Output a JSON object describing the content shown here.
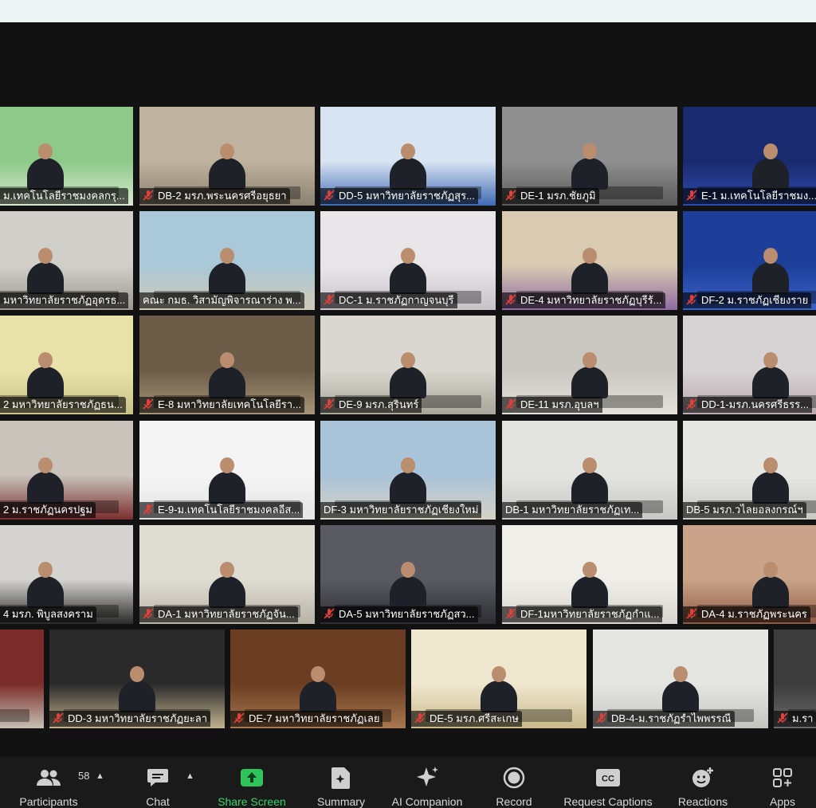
{
  "colors": {
    "accent_green": "#2fc45c",
    "mute_red": "#e0403a",
    "toolbar_bg": "#1a1a1a",
    "stage_bg": "#121212"
  },
  "tiles": [
    {
      "label": "ม.เทคโนโลยีราชมงคลกรุ...",
      "muted": false,
      "bg": "#8ec98a",
      "bg2": "#d8e9cf"
    },
    {
      "label": "DB-2 มรภ.พระนครศรีอยุธยา",
      "muted": true,
      "bg": "#bfb39f",
      "bg2": "#8b8170"
    },
    {
      "label": "DD-5 มหาวิทยาลัยราชภัฏสุร...",
      "muted": true,
      "bg": "#d9e4f2",
      "bg2": "#3f6bb5"
    },
    {
      "label": "DE-1 มรภ.ชัยภูมิ",
      "muted": true,
      "bg": "#8f8f8f",
      "bg2": "#5a5a5a"
    },
    {
      "label": "E-1 ม.เทคโนโลยีราชมง...",
      "muted": true,
      "bg": "#1a2a6e",
      "bg2": "#2f4bb0"
    },
    {
      "label": "มหาวิทยาลัยราชภัฏอุดรธ...",
      "muted": false,
      "bg": "#d0cfc9",
      "bg2": "#9a9890"
    },
    {
      "label": "คณะ กมธ. วิสามัญพิจารณาร่าง พ...",
      "muted": false,
      "bg": "#a9c8d8",
      "bg2": "#d2c9b5"
    },
    {
      "label": "DC-1 ม.ราชภัฏกาญจนบุรี",
      "muted": true,
      "bg": "#e9e6ea",
      "bg2": "#c8c2c8"
    },
    {
      "label": "DE-4 มหาวิทยาลัยราชภัฏบุรีรั...",
      "muted": true,
      "bg": "#d8cbb2",
      "bg2": "#8f6aa0"
    },
    {
      "label": "DF-2 ม.ราชภัฏเชียงราย",
      "muted": true,
      "bg": "#1d3f9a",
      "bg2": "#3a62c8"
    },
    {
      "label": "2 มหาวิทยาลัยราชภัฏธน...",
      "muted": false,
      "bg": "#e8e2a8",
      "bg2": "#c9c289"
    },
    {
      "label": "E-8 มหาวิทยาลัยเทคโนโลยีรา...",
      "muted": true,
      "bg": "#6d5d48",
      "bg2": "#a59479"
    },
    {
      "label": "DE-9 มรภ.สุรินทร์",
      "muted": true,
      "bg": "#d9d7cf",
      "bg2": "#a8a59a"
    },
    {
      "label": "DE-11 มรภ.อุบลฯ",
      "muted": true,
      "bg": "#c9c7bf",
      "bg2": "#e3e1da"
    },
    {
      "label": "DD-1-มรภ.นครศรีธรร...",
      "muted": true,
      "bg": "#d7d3d5",
      "bg2": "#b9a9b0"
    },
    {
      "label": "2 ม.ราชภัฏนครปฐม",
      "muted": false,
      "bg": "#c9c3bb",
      "bg2": "#7a2e2e"
    },
    {
      "label": "E-9-ม.เทคโนโลยีราชมงคลอีส...",
      "muted": true,
      "bg": "#f4f4f4",
      "bg2": "#e4e4e4"
    },
    {
      "label": "DF-3 มหาวิทยาลัยราชภัฏเชียงใหม่",
      "muted": false,
      "bg": "#a9c3d9",
      "bg2": "#d6d2c4"
    },
    {
      "label": "DB-1 มหาวิทยาลัยราชภัฏเท...",
      "muted": false,
      "bg": "#e3e3e0",
      "bg2": "#c7c7c3"
    },
    {
      "label": "DB-5 มรภ.วไลยอลงกรณ์ฯ",
      "muted": false,
      "bg": "#e6e6e2",
      "bg2": "#c9c9c4"
    },
    {
      "label": "4 มรภ. พิบูลสงคราม",
      "muted": false,
      "bg": "#d4d3cf",
      "bg2": "#2a2a2a"
    },
    {
      "label": "DA-1 มหาวิทยาลัยราชภัฏจัน...",
      "muted": true,
      "bg": "#dfdcd2",
      "bg2": "#b7b2a4"
    },
    {
      "label": "DA-5 มหาวิทยาลัยราชภัฏสว...",
      "muted": true,
      "bg": "#5a5a62",
      "bg2": "#2d2d33"
    },
    {
      "label": "DF-1มหาวิทยาลัยราชภัฏกำแ...",
      "muted": true,
      "bg": "#efeee9",
      "bg2": "#d7d5cf"
    },
    {
      "label": "DA-4 ม.ราชภัฏพระนคร",
      "muted": true,
      "bg": "#c9a48a",
      "bg2": "#8f5a43"
    },
    {
      "label": "",
      "muted": false,
      "bg": "#7a2d2a",
      "bg2": "#c7c0b5"
    },
    {
      "label": "DD-3 มหาวิทยาลัยราชภัฏยะลา",
      "muted": true,
      "bg": "#2a2a2a",
      "bg2": "#c2b38f"
    },
    {
      "label": "DE-7 มหาวิทยาลัยราชภัฏเลย",
      "muted": true,
      "bg": "#6b3d22",
      "bg2": "#a8784f"
    },
    {
      "label": "DE-5 มรภ.ศรีสะเกษ",
      "muted": true,
      "bg": "#efe7d0",
      "bg2": "#c9b98a"
    },
    {
      "label": "DB-4-ม.ราชภัฏรำไพพรรณี",
      "muted": true,
      "bg": "#e5e5e2",
      "bg2": "#c5c5c0"
    },
    {
      "label": "ม.รา",
      "muted": true,
      "bg": "#3c3c3c",
      "bg2": "#6a6a6a"
    }
  ],
  "toolbar": {
    "participants_label": "Participants",
    "participants_count": "58",
    "chat_label": "Chat",
    "share_label": "Share Screen",
    "summary_label": "Summary",
    "ai_label": "AI Companion",
    "record_label": "Record",
    "captions_label": "Request Captions",
    "reactions_label": "Reactions",
    "apps_label": "Apps"
  }
}
